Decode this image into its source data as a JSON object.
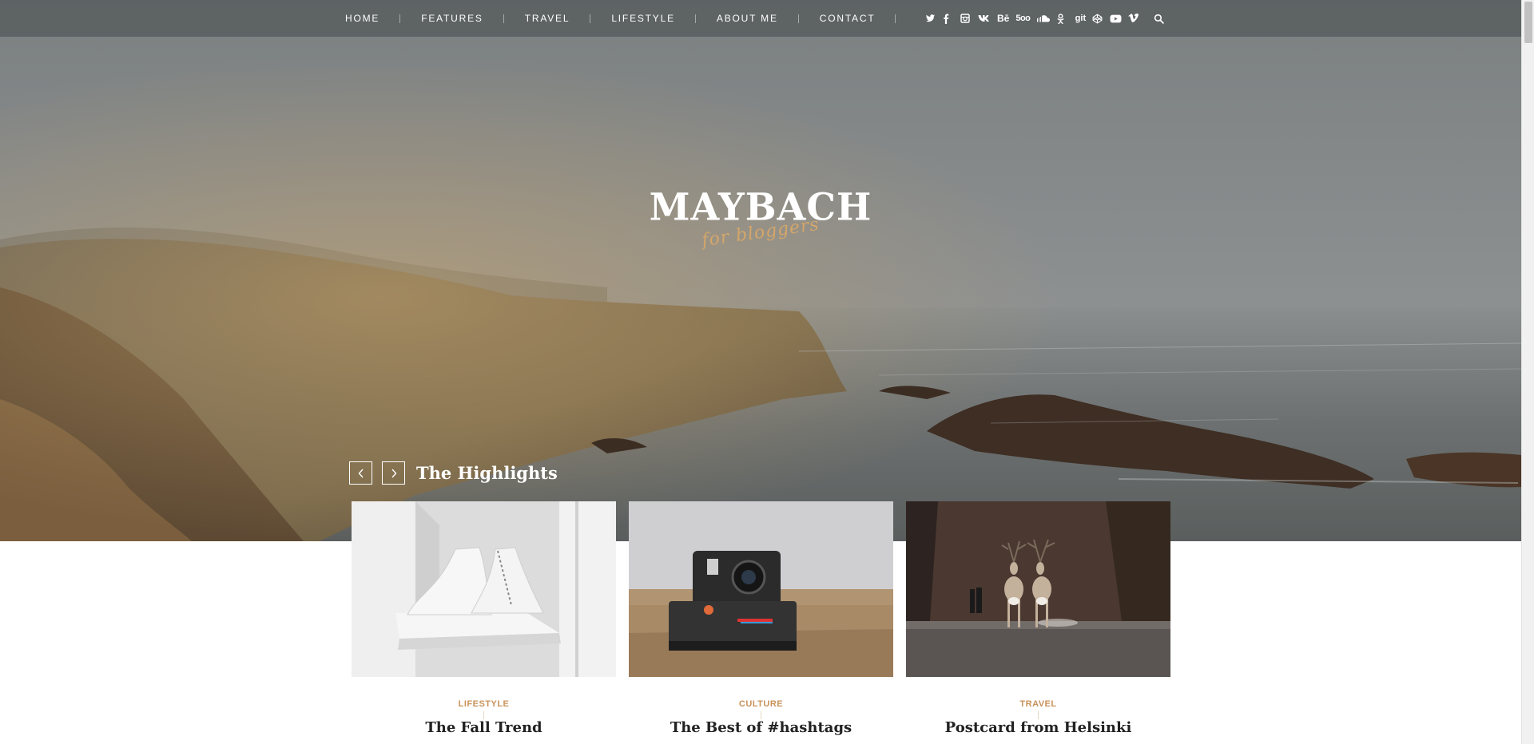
{
  "nav": {
    "items": [
      "HOME",
      "FEATURES",
      "TRAVEL",
      "LIFESTYLE",
      "ABOUT ME",
      "CONTACT"
    ],
    "socials": [
      {
        "icon": "twitter-icon",
        "glyph": "t"
      },
      {
        "icon": "facebook-icon",
        "glyph": "f"
      },
      {
        "icon": "instagram-icon",
        "glyph": "◘"
      },
      {
        "icon": "vk-icon",
        "glyph": "vk"
      },
      {
        "icon": "behance-icon",
        "glyph": "Bē"
      },
      {
        "icon": "500px-icon",
        "glyph": "5oo"
      },
      {
        "icon": "soundcloud-icon",
        "glyph": "☁"
      },
      {
        "icon": "odnoklassniki-icon",
        "glyph": "ok"
      },
      {
        "icon": "github-icon",
        "glyph": "git"
      },
      {
        "icon": "codepen-icon",
        "glyph": "◈"
      },
      {
        "icon": "youtube-icon",
        "glyph": "▶"
      },
      {
        "icon": "vimeo-icon",
        "glyph": "v"
      }
    ],
    "search_icon": "search-icon"
  },
  "logo": {
    "title": "MAYBACH",
    "subtitle": "for bloggers"
  },
  "highlights": {
    "heading": "The Highlights",
    "prev_icon": "chevron-left-icon",
    "next_icon": "chevron-right-icon",
    "cards": [
      {
        "category": "LIFESTYLE",
        "title": "The Fall Trend"
      },
      {
        "category": "CULTURE",
        "title": "The Best of #hashtags"
      },
      {
        "category": "TRAVEL",
        "title": "Postcard from Helsinki"
      }
    ]
  },
  "colors": {
    "accent": "#c9925a",
    "logo_sub": "#d4a66a",
    "title_text": "#222222",
    "nav_bg": "#5f6466"
  }
}
